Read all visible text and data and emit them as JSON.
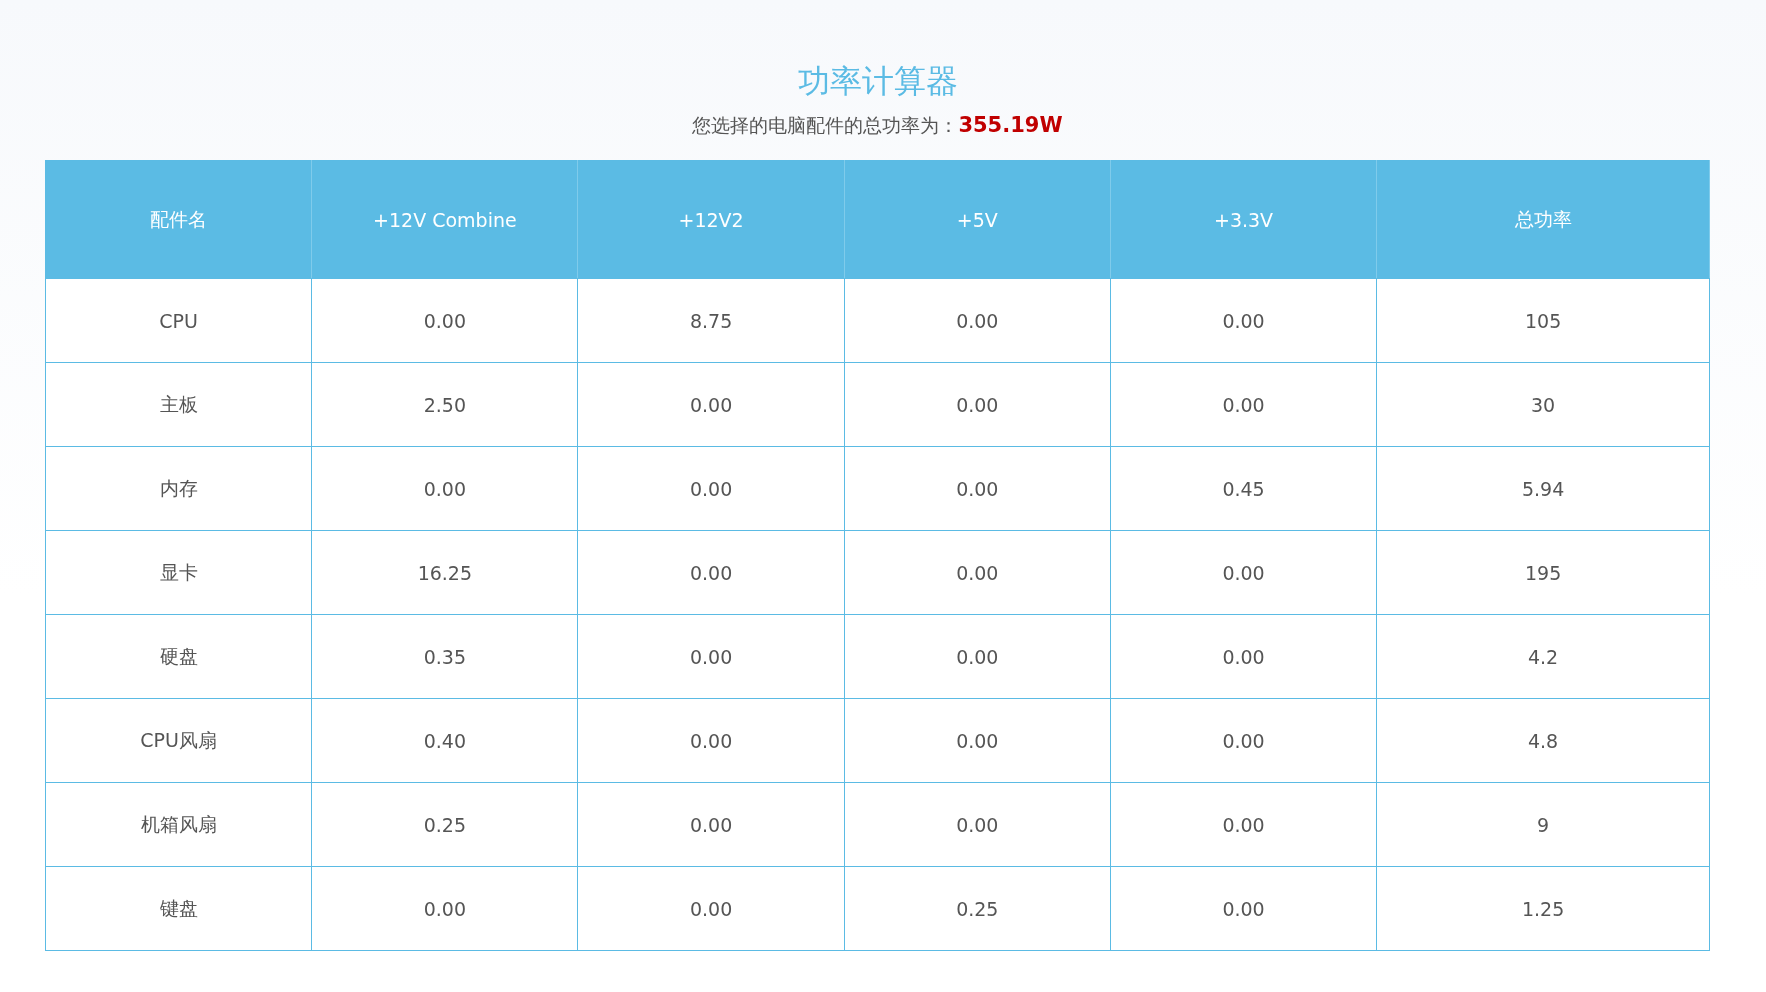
{
  "title": "功率计算器",
  "summary": {
    "label": "您选择的电脑配件的总功率为：",
    "total": "355.19W"
  },
  "table": {
    "columns": [
      "配件名",
      "+12V Combine",
      "+12V2",
      "+5V",
      "+3.3V",
      "总功率"
    ],
    "rows": [
      [
        "CPU",
        "0.00",
        "8.75",
        "0.00",
        "0.00",
        "105"
      ],
      [
        "主板",
        "2.50",
        "0.00",
        "0.00",
        "0.00",
        "30"
      ],
      [
        "内存",
        "0.00",
        "0.00",
        "0.00",
        "0.45",
        "5.94"
      ],
      [
        "显卡",
        "16.25",
        "0.00",
        "0.00",
        "0.00",
        "195"
      ],
      [
        "硬盘",
        "0.35",
        "0.00",
        "0.00",
        "0.00",
        "4.2"
      ],
      [
        "CPU风扇",
        "0.40",
        "0.00",
        "0.00",
        "0.00",
        "4.8"
      ],
      [
        "机箱风扇",
        "0.25",
        "0.00",
        "0.00",
        "0.00",
        "9"
      ],
      [
        "键盘",
        "0.00",
        "0.00",
        "0.25",
        "0.00",
        "1.25"
      ]
    ]
  }
}
